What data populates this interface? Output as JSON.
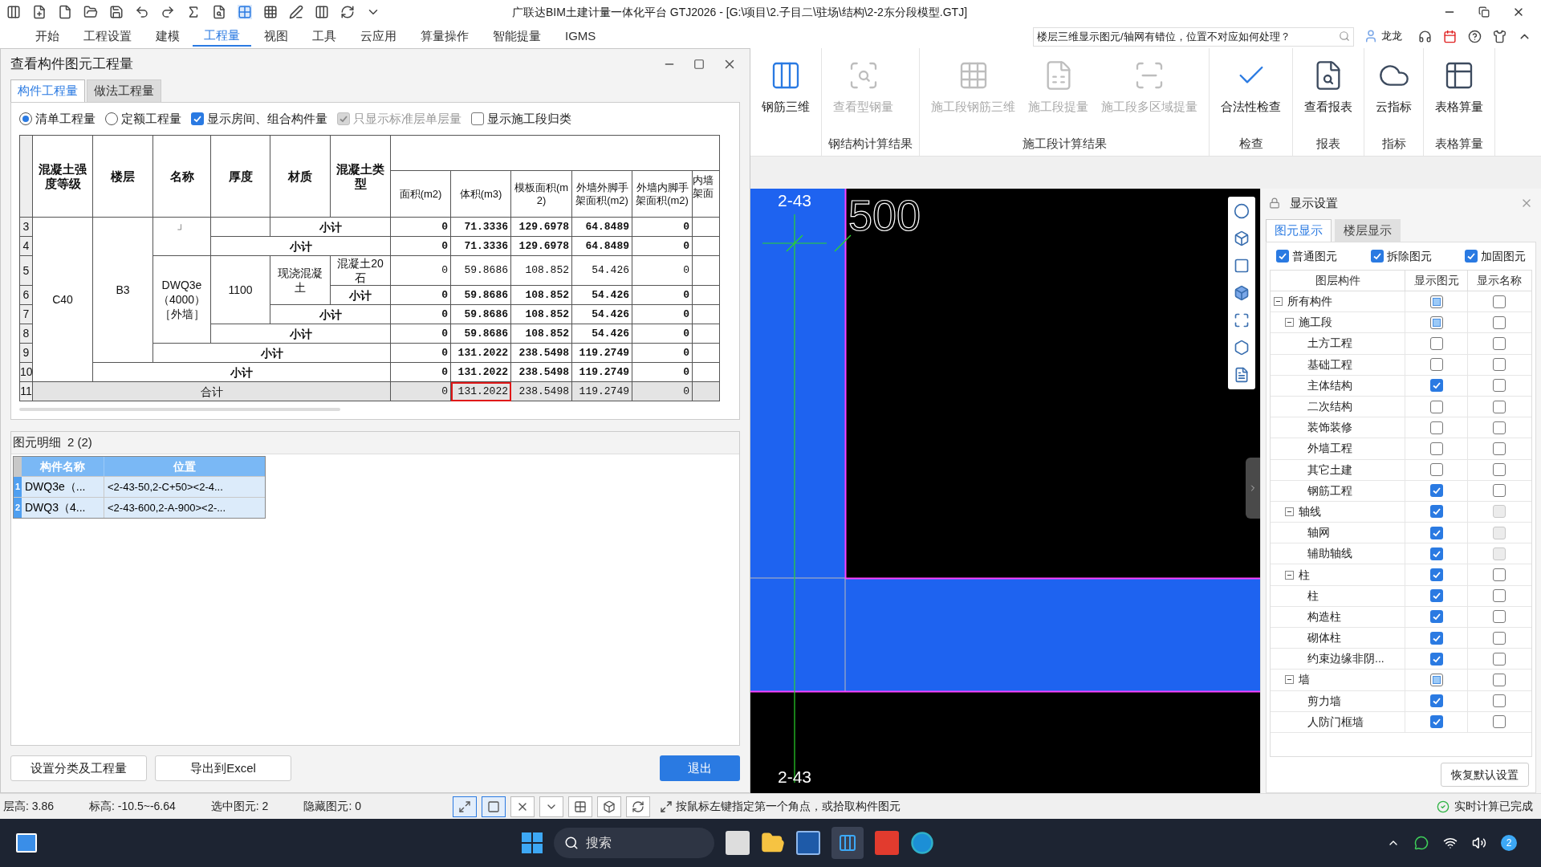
{
  "title_bar": {
    "title": "广联达BIM土建计量一体化平台 GTJ2026 - [G:\\项目\\2.子目二\\驻场\\结构\\2-2东分段模型.GTJ]"
  },
  "menu": [
    {
      "label": "开始",
      "selected": false
    },
    {
      "label": "工程设置",
      "selected": false
    },
    {
      "label": "建模",
      "selected": false
    },
    {
      "label": "工程量",
      "selected": true
    },
    {
      "label": "视图",
      "selected": false
    },
    {
      "label": "工具",
      "selected": false
    },
    {
      "label": "云应用",
      "selected": false
    },
    {
      "label": "算量操作",
      "selected": false
    },
    {
      "label": "智能提量",
      "selected": false
    },
    {
      "label": "IGMS",
      "selected": false
    }
  ],
  "help_search": {
    "value": "楼层三维显示图元/轴网有错位，位置不对应如何处理？"
  },
  "user": {
    "name": "龙龙"
  },
  "ribbon": {
    "groups": [
      {
        "items": [
          {
            "label": "钢筋三维",
            "disabled": false
          }
        ]
      },
      {
        "label": "钢结构计算结果",
        "items": [
          {
            "label": "查看型钢量",
            "disabled": true
          }
        ]
      },
      {
        "label": "施工段计算结果",
        "items": [
          {
            "label": "施工段钢筋三维",
            "disabled": true
          },
          {
            "label": "施工段提量",
            "disabled": true
          },
          {
            "label": "施工段多区域提量",
            "disabled": true
          }
        ]
      },
      {
        "label": "检查",
        "items": [
          {
            "label": "合法性检查",
            "disabled": false
          }
        ]
      },
      {
        "label": "报表",
        "items": [
          {
            "label": "查看报表",
            "disabled": false
          }
        ]
      },
      {
        "label": "指标",
        "items": [
          {
            "label": "云指标",
            "disabled": false
          }
        ]
      },
      {
        "label": "表格算量",
        "items": [
          {
            "label": "表格算量",
            "disabled": false
          }
        ]
      }
    ]
  },
  "dialog": {
    "title": "查看构件图元工程量",
    "tabs": [
      {
        "label": "构件工程量",
        "selected": true
      },
      {
        "label": "做法工程量",
        "selected": false
      }
    ],
    "options": [
      {
        "kind": "radio",
        "label": "清单工程量",
        "selected": true,
        "disabled": false
      },
      {
        "kind": "radio",
        "label": "定额工程量",
        "selected": false,
        "disabled": false
      },
      {
        "kind": "checkbox",
        "label": "显示房间、组合构件量",
        "checked": true,
        "disabled": false
      },
      {
        "kind": "checkbox",
        "label": "只显示标准层单层量",
        "checked": true,
        "disabled": true
      },
      {
        "kind": "checkbox",
        "label": "显示施工段归类",
        "checked": false,
        "disabled": false
      }
    ],
    "table": {
      "label_columns": [
        "混凝土强度等级",
        "楼层",
        "名称",
        "厚度",
        "材质",
        "混凝土类型"
      ],
      "value_columns": [
        "面积(m2)",
        "体积(m3)",
        "模板面积(m2)",
        "外墙外脚手架面积(m2)",
        "外墙内脚手架面积(m2)",
        "内墙架面"
      ],
      "rows": [
        {
          "number": "3",
          "kind": "subtotal",
          "labels": [
            "C40",
            "B3",
            "」",
            "小计"
          ],
          "values": [
            {
              "text": "0",
              "outlined": false
            },
            {
              "text": "71.3336",
              "outlined": false
            },
            {
              "text": "129.6978",
              "outlined": false
            },
            {
              "text": "64.8489",
              "outlined": false
            },
            {
              "text": "0",
              "outlined": false
            }
          ]
        },
        {
          "number": "4",
          "kind": "subtotal",
          "labels": [
            "小计"
          ],
          "values": [
            {
              "text": "0",
              "outlined": false
            },
            {
              "text": "71.3336",
              "outlined": false
            },
            {
              "text": "129.6978",
              "outlined": false
            },
            {
              "text": "64.8489",
              "outlined": false
            },
            {
              "text": "0",
              "outlined": false
            }
          ]
        },
        {
          "number": "5",
          "kind": "detail",
          "labels": [
            "DWQ3e（4000）［外墙］",
            "1100",
            "现浇混凝土",
            "混凝土20石"
          ],
          "values": [
            {
              "text": "0",
              "outlined": false
            },
            {
              "text": "59.8686",
              "outlined": false
            },
            {
              "text": "108.852",
              "outlined": false
            },
            {
              "text": "54.426",
              "outlined": false
            },
            {
              "text": "0",
              "outlined": false
            }
          ]
        },
        {
          "number": "6",
          "kind": "subtotal",
          "labels": [
            "小计"
          ],
          "values": [
            {
              "text": "0",
              "outlined": false
            },
            {
              "text": "59.8686",
              "outlined": false
            },
            {
              "text": "108.852",
              "outlined": false
            },
            {
              "text": "54.426",
              "outlined": false
            },
            {
              "text": "0",
              "outlined": false
            }
          ]
        },
        {
          "number": "7",
          "kind": "subtotal",
          "labels": [
            "小计"
          ],
          "values": [
            {
              "text": "0",
              "outlined": false
            },
            {
              "text": "59.8686",
              "outlined": false
            },
            {
              "text": "108.852",
              "outlined": false
            },
            {
              "text": "54.426",
              "outlined": false
            },
            {
              "text": "0",
              "outlined": false
            }
          ]
        },
        {
          "number": "8",
          "kind": "subtotal",
          "labels": [
            "小计"
          ],
          "values": [
            {
              "text": "0",
              "outlined": false
            },
            {
              "text": "59.8686",
              "outlined": false
            },
            {
              "text": "108.852",
              "outlined": false
            },
            {
              "text": "54.426",
              "outlined": false
            },
            {
              "text": "0",
              "outlined": false
            }
          ]
        },
        {
          "number": "9",
          "kind": "subtotal",
          "labels": [
            "小计"
          ],
          "values": [
            {
              "text": "0",
              "outlined": false
            },
            {
              "text": "131.2022",
              "outlined": false
            },
            {
              "text": "238.5498",
              "outlined": false
            },
            {
              "text": "119.2749",
              "outlined": false
            },
            {
              "text": "0",
              "outlined": false
            }
          ]
        },
        {
          "number": "10",
          "kind": "subtotal",
          "labels": [
            "小计"
          ],
          "values": [
            {
              "text": "0",
              "outlined": false
            },
            {
              "text": "131.2022",
              "outlined": false
            },
            {
              "text": "238.5498",
              "outlined": false
            },
            {
              "text": "119.2749",
              "outlined": false
            },
            {
              "text": "0",
              "outlined": false
            }
          ]
        },
        {
          "number": "11",
          "kind": "total",
          "labels": [
            "合计"
          ],
          "values": [
            {
              "text": "0",
              "outlined": false
            },
            {
              "text": "131.2022",
              "outlined": true
            },
            {
              "text": "238.5498",
              "outlined": false
            },
            {
              "text": "119.2749",
              "outlined": false
            },
            {
              "text": "0",
              "outlined": false
            }
          ]
        }
      ]
    },
    "detail": {
      "title": "图元明细",
      "count": "2 (2)",
      "columns": [
        "构件名称",
        "位置"
      ],
      "rows": [
        {
          "number": "1",
          "name": "DWQ3e（...",
          "position": "<2-43-50,2-C+50><2-4...",
          "selected": true
        },
        {
          "number": "2",
          "name": "DWQ3（4...",
          "position": "<2-43-600,2-A-900><2-...",
          "selected": true
        }
      ]
    },
    "buttons": [
      {
        "label": "设置分类及工程量",
        "kind": "normal"
      },
      {
        "label": "导出到Excel",
        "kind": "normal"
      },
      {
        "label": "退出",
        "kind": "primary"
      }
    ]
  },
  "canvas": {
    "axis_top": "2-43",
    "dimension": "500",
    "axis_bottom": "2-43"
  },
  "display_settings": {
    "title": "显示设置",
    "tabs": [
      {
        "label": "图元显示",
        "selected": true
      },
      {
        "label": "楼层显示",
        "selected": false
      }
    ],
    "filters": [
      {
        "label": "普通图元",
        "checked": true
      },
      {
        "label": "拆除图元",
        "checked": true
      },
      {
        "label": "加固图元",
        "checked": true
      }
    ],
    "columns": [
      "图层构件",
      "显示图元",
      "显示名称"
    ],
    "tree": [
      {
        "label": "所有构件",
        "checked": true,
        "partial": true,
        "name_disabled": false,
        "expanded": true,
        "children": [
          {
            "label": "施工段",
            "checked": true,
            "partial": true,
            "name_disabled": false,
            "expanded": true,
            "children": [
              {
                "label": "土方工程",
                "checked": false,
                "name_disabled": false
              },
              {
                "label": "基础工程",
                "checked": false,
                "name_disabled": false
              },
              {
                "label": "主体结构",
                "checked": true,
                "name_disabled": false
              },
              {
                "label": "二次结构",
                "checked": false,
                "name_disabled": false
              },
              {
                "label": "装饰装修",
                "checked": false,
                "name_disabled": false
              },
              {
                "label": "外墙工程",
                "checked": false,
                "name_disabled": false
              },
              {
                "label": "其它土建",
                "checked": false,
                "name_disabled": false
              },
              {
                "label": "钢筋工程",
                "checked": true,
                "name_disabled": false
              }
            ]
          },
          {
            "label": "轴线",
            "checked": true,
            "name_disabled": true,
            "expanded": true,
            "children": [
              {
                "label": "轴网",
                "checked": true,
                "name_disabled": true
              },
              {
                "label": "辅助轴线",
                "checked": true,
                "name_disabled": true
              }
            ]
          },
          {
            "label": "柱",
            "checked": true,
            "name_disabled": false,
            "expanded": true,
            "children": [
              {
                "label": "柱",
                "checked": true,
                "name_disabled": false
              },
              {
                "label": "构造柱",
                "checked": true,
                "name_disabled": false
              },
              {
                "label": "砌体柱",
                "checked": true,
                "name_disabled": false
              },
              {
                "label": "约束边缘非阴...",
                "checked": true,
                "name_disabled": false
              }
            ]
          },
          {
            "label": "墙",
            "checked": true,
            "partial": true,
            "name_disabled": false,
            "expanded": true,
            "children": [
              {
                "label": "剪力墙",
                "checked": true,
                "name_disabled": false
              },
              {
                "label": "人防门框墙",
                "checked": true,
                "name_disabled": false
              }
            ]
          }
        ]
      }
    ],
    "reset_button": "恢复默认设置"
  },
  "status_bar": {
    "items": [
      "层高: 3.86",
      "标高: -10.5~-6.64",
      "选中图元: 2",
      "隐藏图元: 0"
    ],
    "tools": [
      {
        "selected": true
      },
      {
        "selected": true
      },
      {
        "selected": false
      },
      {
        "selected": false
      },
      {
        "selected": false
      },
      {
        "selected": false
      },
      {
        "selected": false
      }
    ],
    "hint": "按鼠标左键指定第一个角点，或拾取构件图元",
    "status": "实时计算已完成"
  },
  "taskbar": {
    "search_placeholder": "搜索",
    "badge": "2"
  }
}
